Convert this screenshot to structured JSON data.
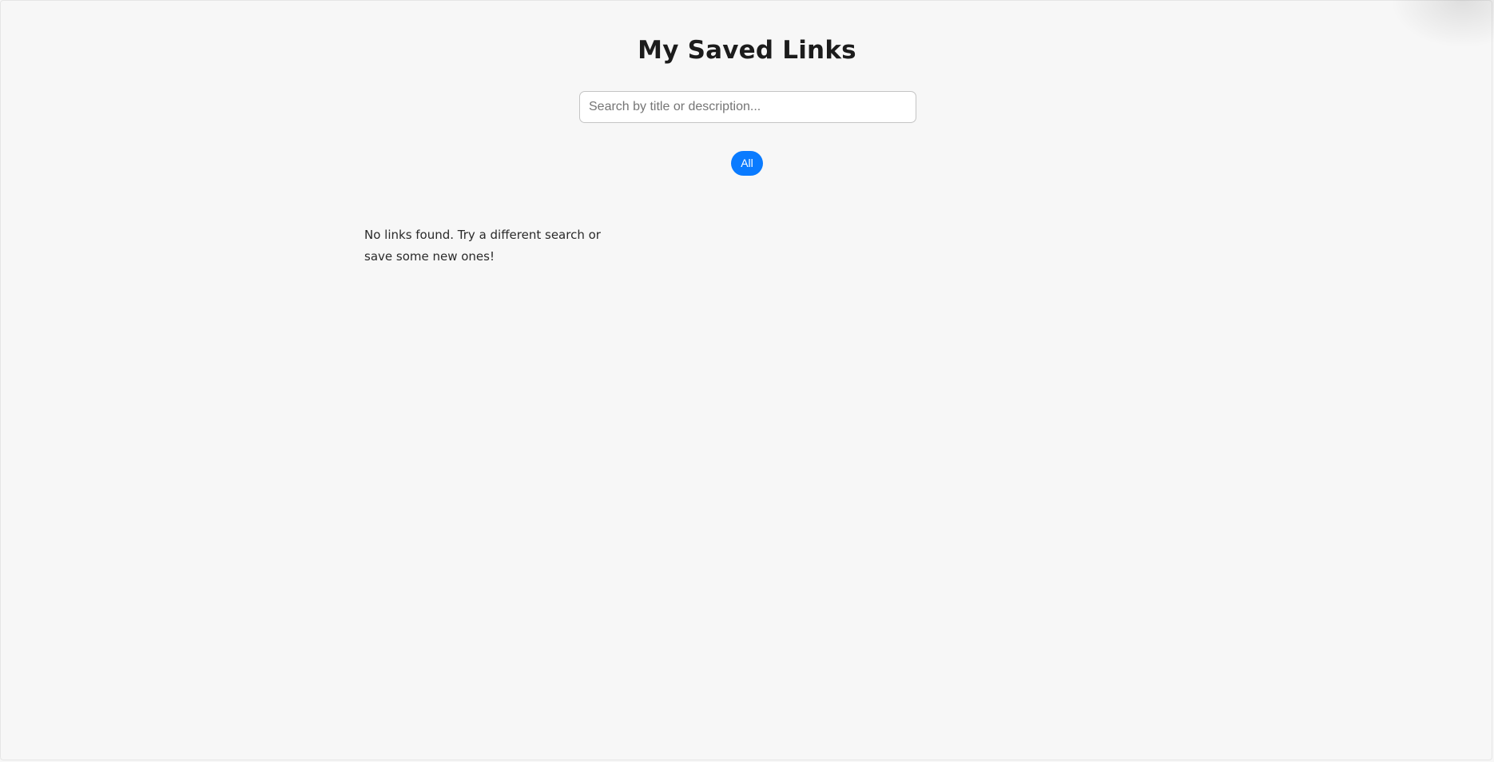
{
  "header": {
    "title": "My Saved Links"
  },
  "search": {
    "placeholder": "Search by title or description...",
    "value": ""
  },
  "filters": {
    "items": [
      {
        "label": "All",
        "active": true
      }
    ]
  },
  "results": {
    "empty_message": "No links found. Try a different search or save some new ones!"
  },
  "colors": {
    "accent": "#0a7bff",
    "background": "#f7f7f7",
    "text": "#1c1c1c"
  }
}
